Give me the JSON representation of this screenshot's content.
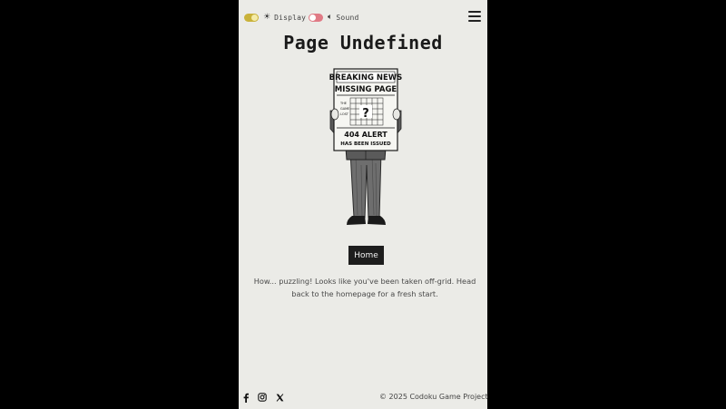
{
  "topbar": {
    "display": {
      "label": "Display",
      "icon": "sun-icon",
      "state": "on",
      "color": "#c9b23a"
    },
    "sound": {
      "label": "Sound",
      "icon": "speaker-muted-icon",
      "state": "off",
      "color": "#e07a85"
    },
    "menu_icon": "hamburger-icon"
  },
  "main": {
    "title": "Page Undefined",
    "illustration": {
      "headline_1": "BREAKING NEWS",
      "headline_2": "MISSING PAGE",
      "side_text_1": "THE",
      "side_text_2": "GAME",
      "side_text_3": "LOST",
      "grid_mark": "?",
      "alert_1": "404 ALERT",
      "alert_2": "HAS BEEN ISSUED"
    },
    "home_button": "Home",
    "message": "How... puzzling! Looks like you've been taken off-grid. Head back to the homepage for a fresh start."
  },
  "footer": {
    "social": [
      "facebook-icon",
      "instagram-icon",
      "x-icon"
    ],
    "copyright": "© 2025 Codoku Game Project"
  },
  "colors": {
    "page_background": "#ebebe7",
    "outer_background": "#000000",
    "button_background": "#1d1d1d"
  }
}
